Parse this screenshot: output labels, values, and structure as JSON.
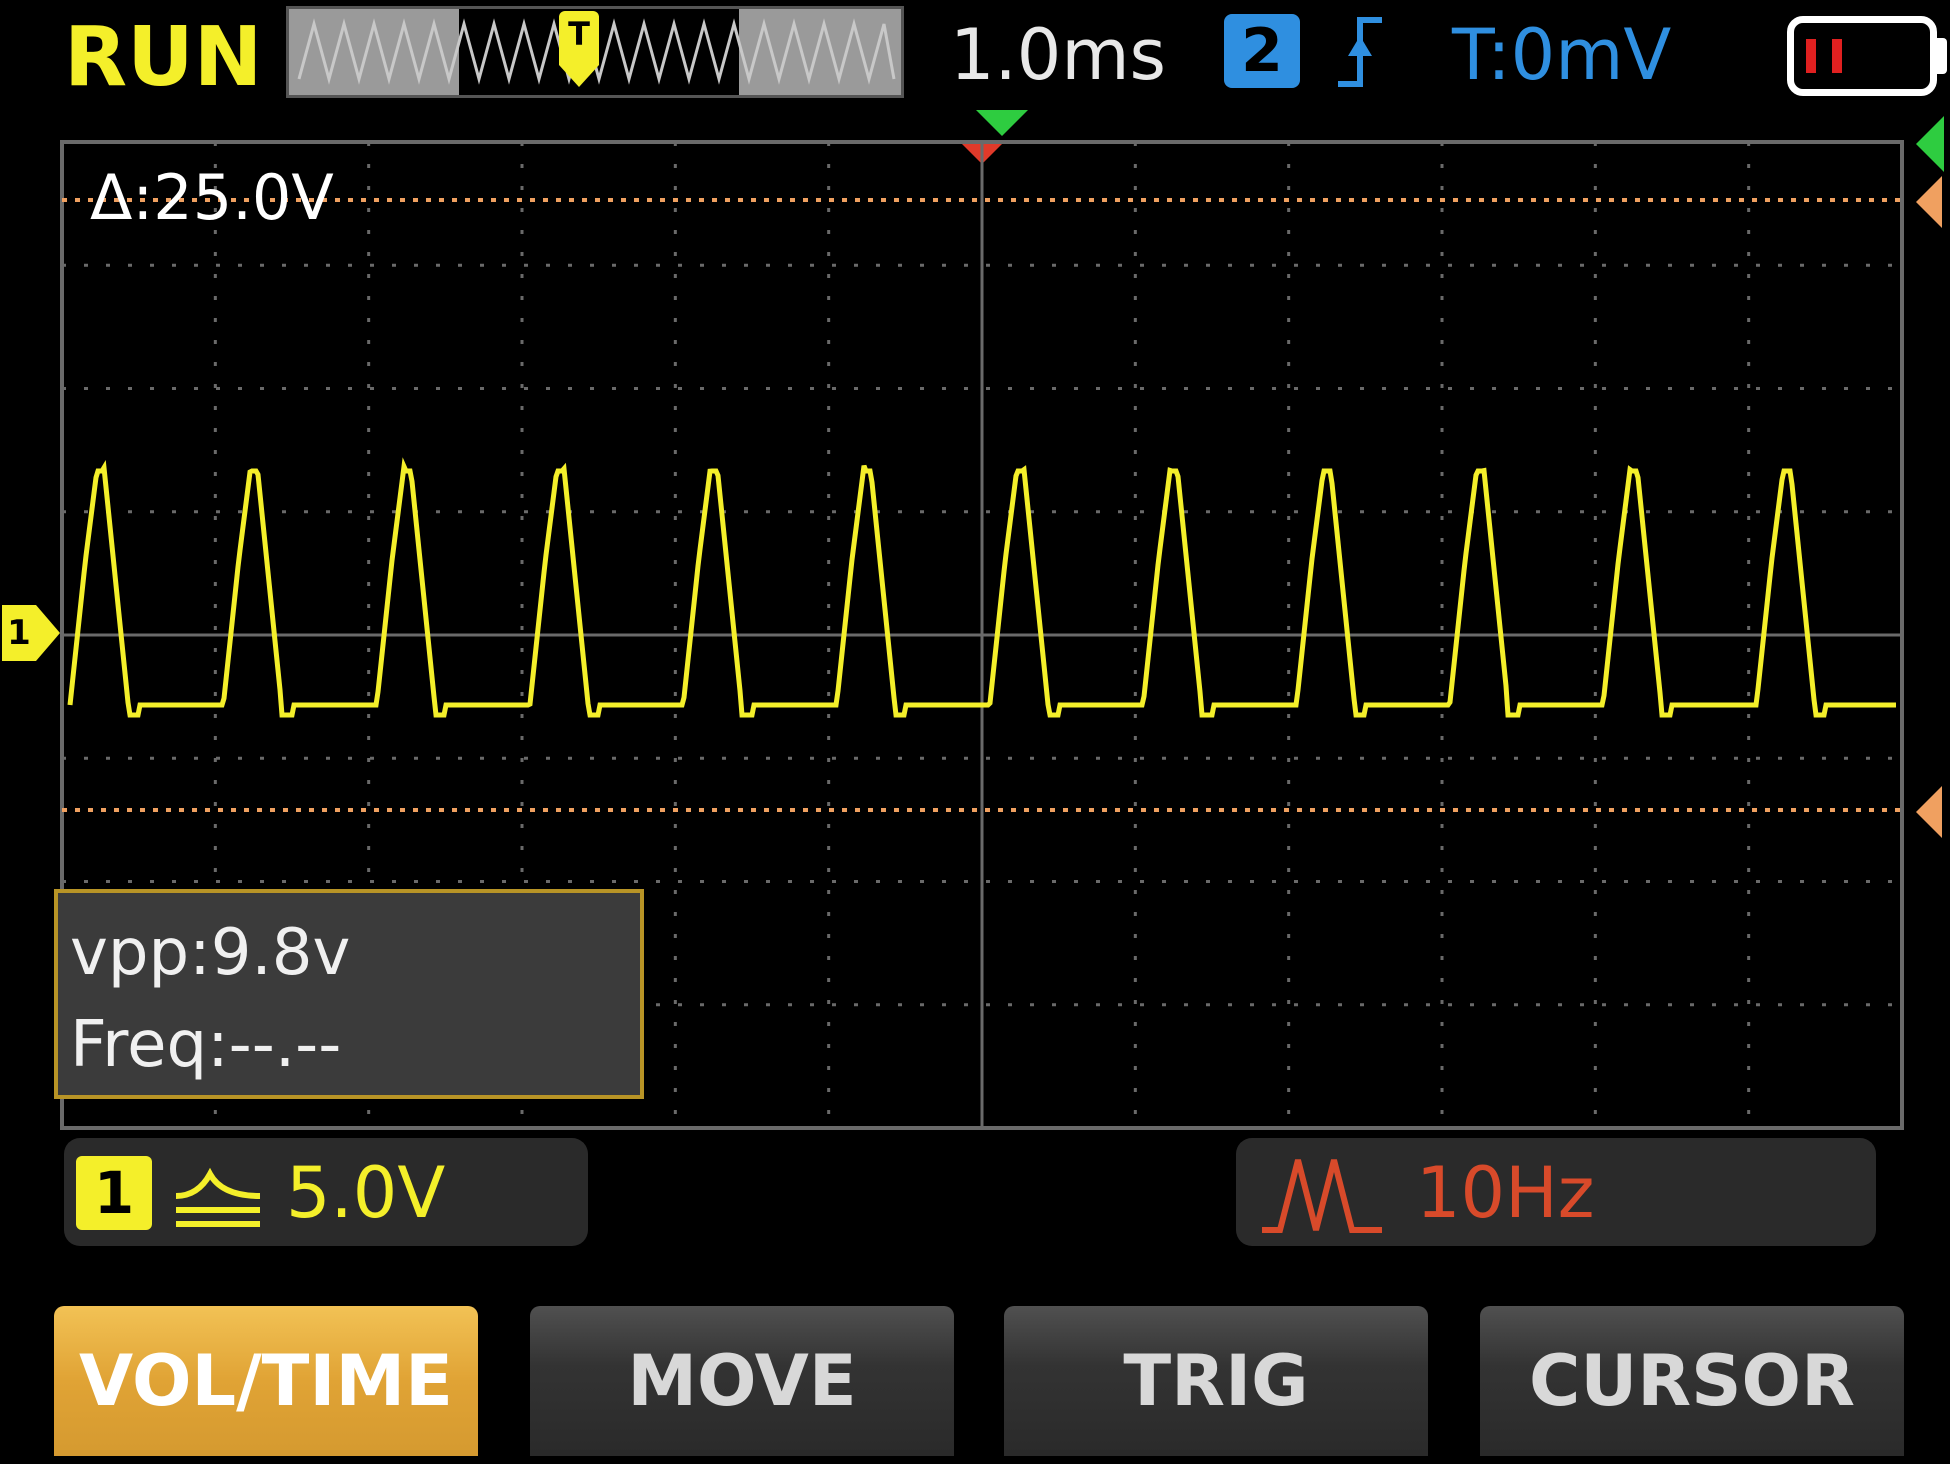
{
  "header": {
    "run_state": "RUN",
    "timebase": "1.0ms",
    "trigger_channel": "2",
    "trigger_edge_icon": "rising-edge-icon",
    "trigger_level": "T:0mV",
    "battery_icon": "battery-low-icon",
    "overview_marker": "T"
  },
  "screen": {
    "cursor_delta": "Δ:25.0V",
    "channel_marker": "1"
  },
  "measurements": {
    "vpp": "vpp:9.8v",
    "freq": "Freq:--.--"
  },
  "channel1": {
    "number": "1",
    "coupling_icon": "dc-coupling-icon",
    "scale": "5.0V"
  },
  "generator": {
    "wave_icon": "pulse-wave-icon",
    "frequency": "10Hz"
  },
  "buttons": {
    "vol_time": "VOL/TIME",
    "move": "MOVE",
    "trig": "TRIG",
    "cursor": "CURSOR"
  },
  "colors": {
    "ch1": "#f4ef2a",
    "ch2": "#2f8fe0",
    "trigger_level_text": "#2f8fe0",
    "cursor": "#f0a060",
    "generator": "#d84a2a",
    "accent_button": "#e0a335"
  }
}
